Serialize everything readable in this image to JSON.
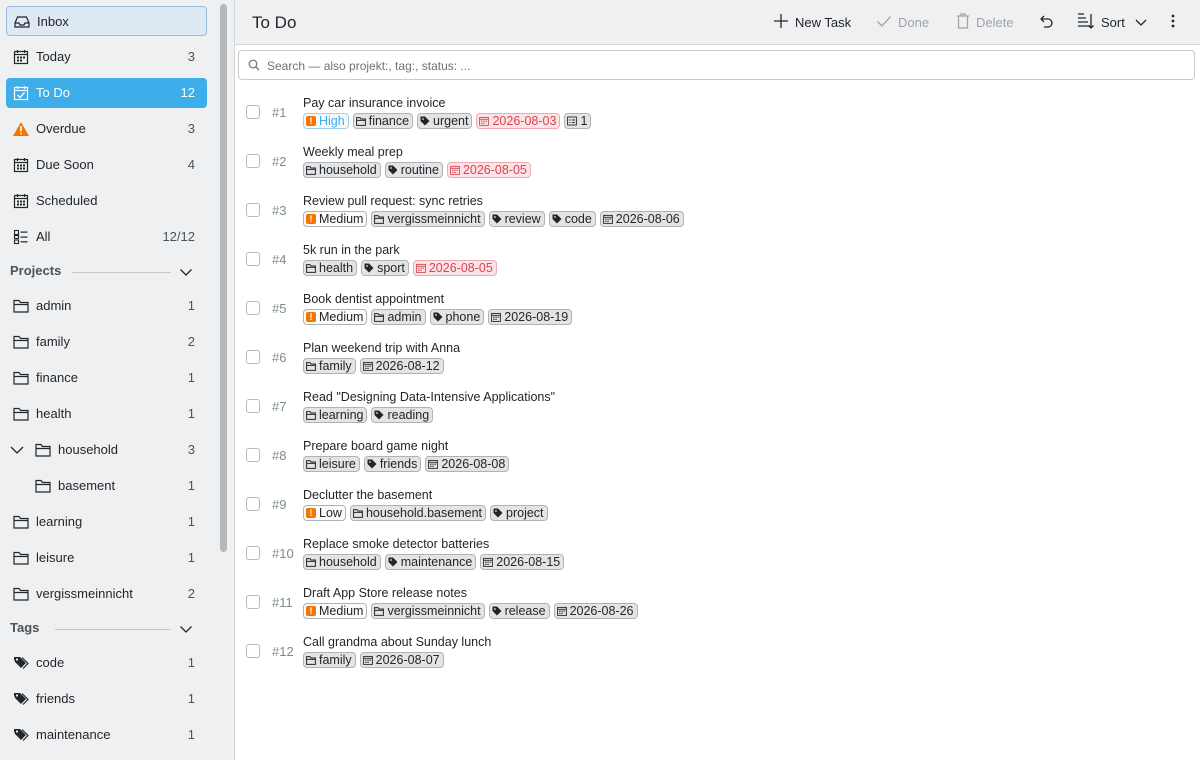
{
  "sidebar": {
    "views": [
      {
        "label": "Inbox",
        "count": "",
        "icon": "inbox-icon"
      },
      {
        "label": "Today",
        "count": "3",
        "icon": "calendar-icon"
      },
      {
        "label": "To Do",
        "count": "12",
        "icon": "checklist-icon"
      },
      {
        "label": "Overdue",
        "count": "3",
        "icon": "warning-icon"
      },
      {
        "label": "Due Soon",
        "count": "4",
        "icon": "calendar-icon"
      },
      {
        "label": "Scheduled",
        "count": "",
        "icon": "calendar-icon"
      },
      {
        "label": "All",
        "count": "12/12",
        "icon": "list-icon"
      }
    ],
    "projects_header": "Projects",
    "projects": [
      {
        "label": "admin",
        "count": "1"
      },
      {
        "label": "family",
        "count": "2"
      },
      {
        "label": "finance",
        "count": "1"
      },
      {
        "label": "health",
        "count": "1"
      },
      {
        "label": "household",
        "count": "3"
      },
      {
        "label": "basement",
        "count": "1"
      },
      {
        "label": "learning",
        "count": "1"
      },
      {
        "label": "leisure",
        "count": "1"
      },
      {
        "label": "vergissmeinnicht",
        "count": "2"
      }
    ],
    "tags_header": "Tags",
    "tags": [
      {
        "label": "code",
        "count": "1"
      },
      {
        "label": "friends",
        "count": "1"
      },
      {
        "label": "maintenance",
        "count": "1"
      }
    ]
  },
  "toolbar": {
    "title": "To Do",
    "new_task": "New Task",
    "done": "Done",
    "delete": "Delete",
    "sort": "Sort"
  },
  "search": {
    "placeholder": "Search — also projekt:, tag:, status: ..."
  },
  "colors": {
    "accent": "#3daee9",
    "priority": "#f67400",
    "overdue": "#da4453"
  },
  "tasks": [
    {
      "num": "#1",
      "title": "Pay car insurance invoice",
      "chips": [
        {
          "kind": "priority-high",
          "text": "High"
        },
        {
          "kind": "project",
          "text": "finance"
        },
        {
          "kind": "tag",
          "text": "urgent"
        },
        {
          "kind": "date-overdue",
          "text": "2026-08-03"
        },
        {
          "kind": "subtasks",
          "text": "1"
        }
      ]
    },
    {
      "num": "#2",
      "title": "Weekly meal prep",
      "chips": [
        {
          "kind": "project",
          "text": "household"
        },
        {
          "kind": "tag",
          "text": "routine"
        },
        {
          "kind": "date-overdue",
          "text": "2026-08-05"
        }
      ]
    },
    {
      "num": "#3",
      "title": "Review pull request: sync retries",
      "chips": [
        {
          "kind": "priority",
          "text": "Medium"
        },
        {
          "kind": "project",
          "text": "vergissmeinnicht"
        },
        {
          "kind": "tag",
          "text": "review"
        },
        {
          "kind": "tag",
          "text": "code"
        },
        {
          "kind": "date",
          "text": "2026-08-06"
        }
      ]
    },
    {
      "num": "#4",
      "title": "5k run in the park",
      "chips": [
        {
          "kind": "project",
          "text": "health"
        },
        {
          "kind": "tag",
          "text": "sport"
        },
        {
          "kind": "date-overdue",
          "text": "2026-08-05"
        }
      ]
    },
    {
      "num": "#5",
      "title": "Book dentist appointment",
      "chips": [
        {
          "kind": "priority",
          "text": "Medium"
        },
        {
          "kind": "project",
          "text": "admin"
        },
        {
          "kind": "tag",
          "text": "phone"
        },
        {
          "kind": "date",
          "text": "2026-08-19"
        }
      ]
    },
    {
      "num": "#6",
      "title": "Plan weekend trip with Anna",
      "chips": [
        {
          "kind": "project",
          "text": "family"
        },
        {
          "kind": "date",
          "text": "2026-08-12"
        }
      ]
    },
    {
      "num": "#7",
      "title": "Read \"Designing Data-Intensive Applications\"",
      "chips": [
        {
          "kind": "project",
          "text": "learning"
        },
        {
          "kind": "tag",
          "text": "reading"
        }
      ]
    },
    {
      "num": "#8",
      "title": "Prepare board game night",
      "chips": [
        {
          "kind": "project",
          "text": "leisure"
        },
        {
          "kind": "tag",
          "text": "friends"
        },
        {
          "kind": "date",
          "text": "2026-08-08"
        }
      ]
    },
    {
      "num": "#9",
      "title": "Declutter the basement",
      "chips": [
        {
          "kind": "priority",
          "text": "Low"
        },
        {
          "kind": "project",
          "text": "household.basement"
        },
        {
          "kind": "tag",
          "text": "project"
        }
      ]
    },
    {
      "num": "#10",
      "title": "Replace smoke detector batteries",
      "chips": [
        {
          "kind": "project",
          "text": "household"
        },
        {
          "kind": "tag",
          "text": "maintenance"
        },
        {
          "kind": "date",
          "text": "2026-08-15"
        }
      ]
    },
    {
      "num": "#11",
      "title": "Draft App Store release notes",
      "chips": [
        {
          "kind": "priority",
          "text": "Medium"
        },
        {
          "kind": "project",
          "text": "vergissmeinnicht"
        },
        {
          "kind": "tag",
          "text": "release"
        },
        {
          "kind": "date",
          "text": "2026-08-26"
        }
      ]
    },
    {
      "num": "#12",
      "title": "Call grandma about Sunday lunch",
      "chips": [
        {
          "kind": "project",
          "text": "family"
        },
        {
          "kind": "date",
          "text": "2026-08-07"
        }
      ]
    }
  ]
}
